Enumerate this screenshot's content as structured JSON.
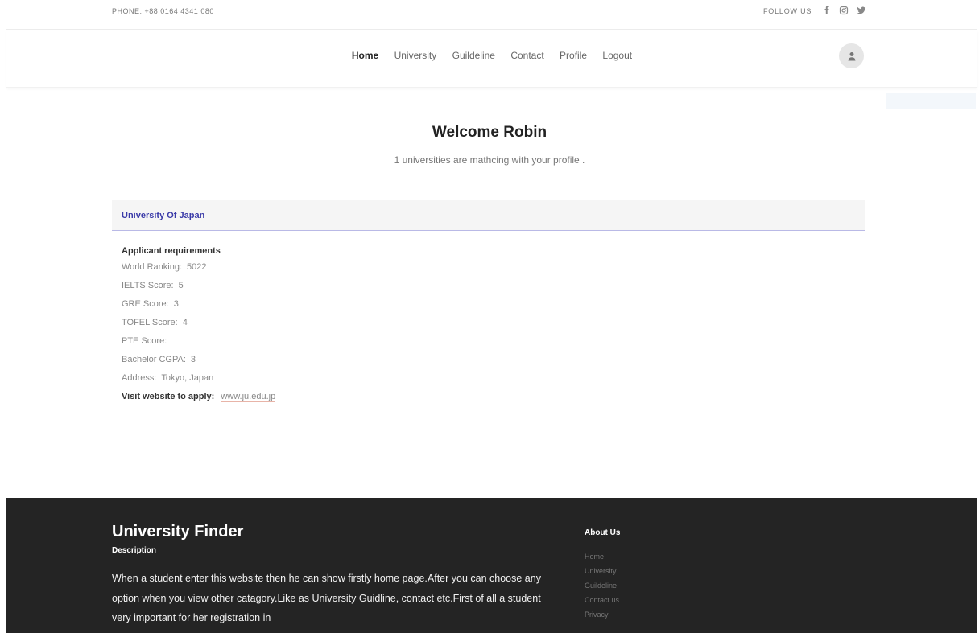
{
  "topbar": {
    "phone": "PHONE:  +88 0164 4341 080",
    "follow": "FOLLOW US",
    "social": [
      "facebook-icon",
      "instagram-icon",
      "twitter-icon"
    ]
  },
  "nav": {
    "items": [
      "Home",
      "University",
      "Guildeline",
      "Contact",
      "Profile",
      "Logout"
    ],
    "active": "Home"
  },
  "welcome": {
    "title": "Welcome Robin",
    "subtitle": "1 universities are mathcing with your profile ."
  },
  "university": {
    "name": "University Of Japan",
    "req_title": "Applicant requirements",
    "rows": [
      {
        "label": "World Ranking:",
        "value": "5022"
      },
      {
        "label": "IELTS Score:",
        "value": "5"
      },
      {
        "label": "GRE Score:",
        "value": "3"
      },
      {
        "label": "TOFEL Score:",
        "value": "4"
      },
      {
        "label": "PTE Score:",
        "value": ""
      },
      {
        "label": "Bachelor CGPA:",
        "value": "3"
      },
      {
        "label": "Address:",
        "value": "Tokyo, Japan"
      }
    ],
    "visit_label": "Visit website to apply:",
    "website": "www.ju.edu.jp"
  },
  "footer": {
    "brand": "University Finder",
    "desc_title": "Description",
    "description": "When a student enter this website then he can show firstly home page.After you can choose any option when you view other catagory.Like as University Guidline, contact etc.First of all a student very important for her registration in",
    "about_title": "About Us",
    "links": [
      "Home",
      "University",
      "Guildeline",
      "Contact us",
      "Privacy"
    ]
  },
  "colors": {
    "footer_bg": "#242424",
    "university_name": "#3a3aa8",
    "card_border": "#b9b9e6"
  }
}
